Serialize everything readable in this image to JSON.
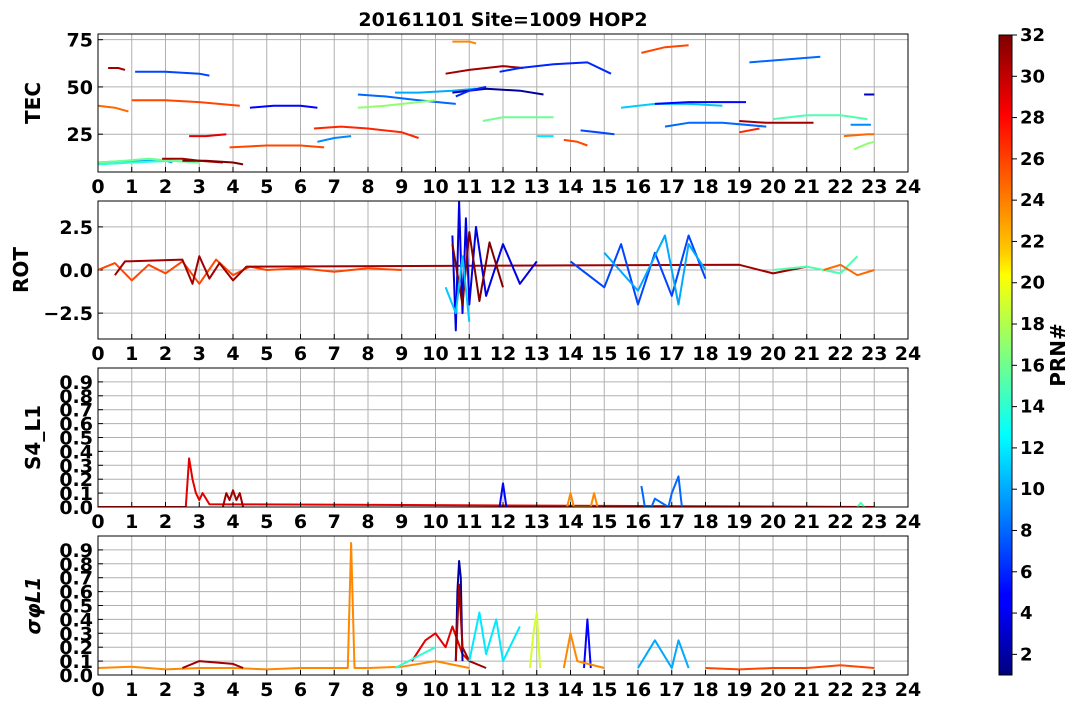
{
  "figure": {
    "title": "20161101 Site=1009 HOP2"
  },
  "x_ticks": [
    "0",
    "1",
    "2",
    "3",
    "4",
    "5",
    "6",
    "7",
    "8",
    "9",
    "10",
    "11",
    "12",
    "13",
    "14",
    "15",
    "16",
    "17",
    "18",
    "19",
    "20",
    "21",
    "22",
    "23",
    "24"
  ],
  "colorbar": {
    "label": "PRN#",
    "ticks": [
      "2",
      "4",
      "6",
      "8",
      "10",
      "12",
      "14",
      "16",
      "18",
      "20",
      "22",
      "24",
      "26",
      "28",
      "30",
      "32"
    ],
    "colormap": "jet",
    "range": [
      1,
      32
    ]
  },
  "chart_data": [
    {
      "type": "line",
      "name": "tec",
      "ylabel": "TEC",
      "xlim": [
        0,
        24
      ],
      "ylim": [
        5,
        78
      ],
      "y_ticks": [
        "25",
        "50",
        "75"
      ],
      "grid": true,
      "series": [
        {
          "prn": 10,
          "x": [
            0.0,
            1.0,
            2.0,
            2.2
          ],
          "y": [
            10,
            11,
            11,
            10
          ]
        },
        {
          "prn": 14,
          "x": [
            0.0,
            1.0,
            2.2,
            3.0
          ],
          "y": [
            9,
            10,
            11,
            10
          ]
        },
        {
          "prn": 16,
          "x": [
            0.0,
            0.8,
            1.5,
            2.2,
            3.0
          ],
          "y": [
            10,
            11,
            12,
            11,
            10
          ]
        },
        {
          "prn": 31,
          "x": [
            1.9,
            2.5,
            3.0,
            3.7
          ],
          "y": [
            12,
            12,
            11,
            10
          ]
        },
        {
          "prn": 32,
          "x": [
            2.5,
            3.2,
            4.0,
            4.3
          ],
          "y": [
            11,
            11,
            10,
            9
          ]
        },
        {
          "prn": 25,
          "x": [
            0.0,
            0.5,
            0.9
          ],
          "y": [
            40,
            39,
            37
          ]
        },
        {
          "prn": 31,
          "x": [
            0.3,
            0.6,
            0.8
          ],
          "y": [
            60,
            60,
            59
          ]
        },
        {
          "prn": 7,
          "x": [
            1.1,
            2.0,
            3.0,
            3.3
          ],
          "y": [
            58,
            58,
            57,
            56
          ]
        },
        {
          "prn": 26,
          "x": [
            1.0,
            2.0,
            3.0,
            4.2
          ],
          "y": [
            43,
            43,
            42,
            40
          ]
        },
        {
          "prn": 29,
          "x": [
            2.7,
            3.2,
            3.8
          ],
          "y": [
            24,
            24,
            25
          ]
        },
        {
          "prn": 26,
          "x": [
            3.9,
            5.0,
            6.0,
            6.7
          ],
          "y": [
            18,
            19,
            19,
            18
          ]
        },
        {
          "prn": 5,
          "x": [
            4.5,
            5.2,
            6.0,
            6.5
          ],
          "y": [
            39,
            40,
            40,
            39
          ]
        },
        {
          "prn": 9,
          "x": [
            6.5,
            7.0,
            7.5
          ],
          "y": [
            21,
            23,
            24
          ]
        },
        {
          "prn": 27,
          "x": [
            6.4,
            7.2,
            8.0,
            9.0,
            9.5
          ],
          "y": [
            28,
            29,
            28,
            26,
            23
          ]
        },
        {
          "prn": 8,
          "x": [
            7.7,
            8.5,
            9.5,
            10.6
          ],
          "y": [
            46,
            45,
            43,
            41
          ]
        },
        {
          "prn": 17,
          "x": [
            7.7,
            8.5,
            9.5,
            10.0
          ],
          "y": [
            39,
            40,
            42,
            43
          ]
        },
        {
          "prn": 10,
          "x": [
            8.8,
            9.5,
            10.5,
            11.2
          ],
          "y": [
            47,
            47,
            48,
            49
          ]
        },
        {
          "prn": 24,
          "x": [
            10.5,
            11.0,
            11.2
          ],
          "y": [
            74,
            74,
            73
          ]
        },
        {
          "prn": 31,
          "x": [
            10.3,
            11.0,
            12.0,
            12.6
          ],
          "y": [
            57,
            59,
            61,
            60
          ]
        },
        {
          "prn": 2,
          "x": [
            10.5,
            11.5,
            12.5,
            13.2
          ],
          "y": [
            47,
            49,
            48,
            46
          ]
        },
        {
          "prn": 6,
          "x": [
            10.6,
            11.0,
            11.5
          ],
          "y": [
            45,
            48,
            50
          ]
        },
        {
          "prn": 6,
          "x": [
            11.9,
            12.5,
            13.5,
            14.5,
            15.2
          ],
          "y": [
            58,
            60,
            62,
            63,
            57
          ]
        },
        {
          "prn": 16,
          "x": [
            11.4,
            12.0,
            13.0,
            13.5
          ],
          "y": [
            32,
            34,
            34,
            34
          ]
        },
        {
          "prn": 12,
          "x": [
            13.0,
            13.5
          ],
          "y": [
            24,
            24
          ]
        },
        {
          "prn": 26,
          "x": [
            13.8,
            14.2,
            14.5
          ],
          "y": [
            22,
            21,
            19
          ]
        },
        {
          "prn": 7,
          "x": [
            14.3,
            14.8,
            15.3
          ],
          "y": [
            27,
            26,
            25
          ]
        },
        {
          "prn": 11,
          "x": [
            15.5,
            16.5,
            17.5,
            18.5
          ],
          "y": [
            39,
            41,
            41,
            40
          ]
        },
        {
          "prn": 5,
          "x": [
            16.5,
            17.5,
            18.5,
            19.2
          ],
          "y": [
            41,
            42,
            42,
            42
          ]
        },
        {
          "prn": 26,
          "x": [
            16.1,
            16.8,
            17.5
          ],
          "y": [
            68,
            71,
            72
          ]
        },
        {
          "prn": 8,
          "x": [
            16.8,
            17.5,
            18.5,
            19.8
          ],
          "y": [
            29,
            31,
            31,
            29
          ]
        },
        {
          "prn": 31,
          "x": [
            19.0,
            19.8,
            20.5,
            21.2
          ],
          "y": [
            32,
            31,
            31,
            31
          ]
        },
        {
          "prn": 27,
          "x": [
            19.0,
            19.6
          ],
          "y": [
            26,
            28
          ]
        },
        {
          "prn": 8,
          "x": [
            19.3,
            20.0,
            21.4
          ],
          "y": [
            63,
            64,
            66
          ]
        },
        {
          "prn": 15,
          "x": [
            20.0,
            21.0,
            22.0,
            22.8
          ],
          "y": [
            33,
            35,
            35,
            33
          ]
        },
        {
          "prn": 9,
          "x": [
            22.3,
            22.9
          ],
          "y": [
            30,
            30
          ]
        },
        {
          "prn": 25,
          "x": [
            22.1,
            22.8,
            23.0
          ],
          "y": [
            24,
            25,
            25
          ]
        },
        {
          "prn": 17,
          "x": [
            22.4,
            22.8,
            23.0
          ],
          "y": [
            17,
            20,
            21
          ]
        },
        {
          "prn": 3,
          "x": [
            22.7,
            23.0
          ],
          "y": [
            46,
            46
          ]
        }
      ]
    },
    {
      "type": "line",
      "name": "rot",
      "ylabel": "ROT",
      "xlim": [
        0,
        24
      ],
      "ylim": [
        -4,
        4
      ],
      "y_ticks": [
        "2.5",
        "0.0",
        "−2.5"
      ],
      "grid": true,
      "series": [
        {
          "prn": 26,
          "x": [
            0.0,
            0.5,
            1.0,
            1.5,
            2.0,
            2.5,
            3.0,
            3.5,
            4.0,
            4.5,
            5.0,
            6.0,
            7.0,
            8.0,
            9.0
          ],
          "y": [
            0.0,
            0.4,
            -0.6,
            0.3,
            -0.2,
            0.5,
            -0.8,
            0.6,
            -0.3,
            0.2,
            0.0,
            0.1,
            -0.1,
            0.1,
            0.0
          ]
        },
        {
          "prn": 31,
          "x": [
            0.5,
            0.8,
            2.5,
            2.8,
            3.0,
            3.3,
            3.6,
            4.0,
            4.4,
            19.0,
            20.0,
            21.0
          ],
          "y": [
            -0.3,
            0.5,
            0.6,
            -0.8,
            0.8,
            -0.5,
            0.4,
            -0.6,
            0.2,
            0.3,
            -0.2,
            0.2
          ]
        },
        {
          "prn": 4,
          "x": [
            10.5,
            10.6,
            10.7,
            10.8,
            10.9,
            11.0,
            11.2,
            11.5,
            12.0,
            12.5,
            13.0
          ],
          "y": [
            2.0,
            -3.5,
            4.0,
            -2.5,
            3.0,
            -2.0,
            2.5,
            -1.5,
            1.5,
            -0.8,
            0.5
          ]
        },
        {
          "prn": 32,
          "x": [
            10.5,
            10.8,
            11.0,
            11.3,
            11.6,
            12.0
          ],
          "y": [
            1.5,
            -2.0,
            2.2,
            -1.8,
            1.6,
            -1.0
          ]
        },
        {
          "prn": 11,
          "x": [
            10.3,
            10.6,
            10.8,
            11.0
          ],
          "y": [
            -1.0,
            -2.5,
            0.8,
            -3.0
          ]
        },
        {
          "prn": 7,
          "x": [
            14.0,
            15.0,
            15.5,
            16.0,
            16.5,
            17.0,
            17.5,
            18.0
          ],
          "y": [
            0.5,
            -1.0,
            1.5,
            -2.0,
            1.0,
            -1.5,
            2.0,
            -0.5
          ]
        },
        {
          "prn": 10,
          "x": [
            15.0,
            16.0,
            16.8,
            17.2,
            17.5,
            18.0
          ],
          "y": [
            1.0,
            -1.2,
            2.0,
            -2.0,
            1.5,
            0.0
          ]
        },
        {
          "prn": 15,
          "x": [
            20.0,
            21.0,
            22.0,
            22.5
          ],
          "y": [
            0.0,
            0.2,
            -0.2,
            0.8
          ]
        },
        {
          "prn": 25,
          "x": [
            21.5,
            22.0,
            22.5,
            23.0
          ],
          "y": [
            0.0,
            0.3,
            -0.3,
            0.0
          ]
        }
      ]
    },
    {
      "type": "line",
      "name": "s4",
      "ylabel": "S4_L1",
      "xlim": [
        0,
        24
      ],
      "ylim": [
        0,
        1.0
      ],
      "y_ticks": [
        "0.9",
        "0.8",
        "0.7",
        "0.6",
        "0.5",
        "0.4",
        "0.3",
        "0.2",
        "0.1",
        "0.0"
      ],
      "grid": true,
      "series": [
        {
          "prn": 29,
          "x": [
            0.0,
            2.6,
            2.7,
            2.8,
            2.9,
            3.0,
            3.1,
            3.3,
            23.0
          ],
          "y": [
            0.0,
            0.0,
            0.35,
            0.2,
            0.1,
            0.05,
            0.1,
            0.02,
            0.0
          ]
        },
        {
          "prn": 31,
          "x": [
            3.7,
            3.8,
            3.9,
            4.0,
            4.1,
            4.2,
            4.3
          ],
          "y": [
            0.0,
            0.1,
            0.05,
            0.12,
            0.05,
            0.1,
            0.0
          ]
        },
        {
          "prn": 5,
          "x": [
            11.9,
            12.0,
            12.1
          ],
          "y": [
            0.0,
            0.17,
            0.0
          ]
        },
        {
          "prn": 24,
          "x": [
            13.9,
            14.0,
            14.1,
            14.6,
            14.7,
            14.8
          ],
          "y": [
            0.0,
            0.1,
            0.0,
            0.0,
            0.1,
            0.0
          ]
        },
        {
          "prn": 8,
          "x": [
            16.1,
            16.15,
            16.2,
            16.4,
            16.5,
            16.9,
            17.0,
            17.2,
            17.3
          ],
          "y": [
            0.15,
            0.08,
            0.0,
            0.0,
            0.06,
            0.0,
            0.1,
            0.22,
            0.0
          ]
        },
        {
          "prn": 15,
          "x": [
            22.5,
            22.6,
            22.7
          ],
          "y": [
            0.0,
            0.03,
            0.0
          ]
        }
      ]
    },
    {
      "type": "line",
      "name": "sigphi",
      "ylabel": "σφL1",
      "xlim": [
        0,
        24
      ],
      "ylim": [
        0,
        1.0
      ],
      "y_ticks": [
        "0.9",
        "0.8",
        "0.7",
        "0.6",
        "0.5",
        "0.4",
        "0.3",
        "0.2",
        "0.1",
        "0.0"
      ],
      "grid": true,
      "series": [
        {
          "prn": 24,
          "x": [
            0.0,
            1.0,
            2.0,
            3.0,
            4.0,
            5.0,
            6.0,
            7.0,
            7.4,
            7.5,
            7.6,
            8.0,
            9.0,
            10.0,
            11.0
          ],
          "y": [
            0.05,
            0.06,
            0.04,
            0.05,
            0.05,
            0.04,
            0.05,
            0.05,
            0.05,
            0.95,
            0.05,
            0.05,
            0.06,
            0.1,
            0.05
          ]
        },
        {
          "prn": 31,
          "x": [
            2.5,
            3.0,
            4.0,
            4.3
          ],
          "y": [
            0.05,
            0.1,
            0.08,
            0.05
          ]
        },
        {
          "prn": 29,
          "x": [
            9.3,
            9.7,
            10.0,
            10.3,
            10.5,
            10.8,
            11.0
          ],
          "y": [
            0.1,
            0.25,
            0.3,
            0.2,
            0.35,
            0.15,
            0.1
          ]
        },
        {
          "prn": 14,
          "x": [
            8.8,
            9.2,
            9.6,
            10.0
          ],
          "y": [
            0.05,
            0.1,
            0.15,
            0.2
          ]
        },
        {
          "prn": 2,
          "x": [
            10.6,
            10.65,
            10.7,
            10.75,
            10.8
          ],
          "y": [
            0.1,
            0.6,
            0.82,
            0.7,
            0.1
          ]
        },
        {
          "prn": 31,
          "x": [
            10.6,
            10.7,
            10.8,
            11.0,
            11.5
          ],
          "y": [
            0.1,
            0.65,
            0.2,
            0.1,
            0.05
          ]
        },
        {
          "prn": 12,
          "x": [
            11.0,
            11.3,
            11.5,
            11.8,
            12.0,
            12.5
          ],
          "y": [
            0.1,
            0.45,
            0.15,
            0.4,
            0.1,
            0.35
          ]
        },
        {
          "prn": 19,
          "x": [
            12.8,
            12.9,
            13.0,
            13.1
          ],
          "y": [
            0.05,
            0.3,
            0.45,
            0.05
          ]
        },
        {
          "prn": 5,
          "x": [
            14.4,
            14.5,
            14.6
          ],
          "y": [
            0.05,
            0.4,
            0.05
          ]
        },
        {
          "prn": 24,
          "x": [
            13.8,
            14.0,
            14.2,
            15.0
          ],
          "y": [
            0.05,
            0.3,
            0.1,
            0.05
          ]
        },
        {
          "prn": 10,
          "x": [
            16.0,
            16.5,
            17.0,
            17.2,
            17.5
          ],
          "y": [
            0.05,
            0.25,
            0.05,
            0.25,
            0.05
          ]
        },
        {
          "prn": 26,
          "x": [
            18.0,
            19.0,
            20.0,
            21.0,
            22.0,
            23.0
          ],
          "y": [
            0.05,
            0.04,
            0.05,
            0.05,
            0.07,
            0.05
          ]
        }
      ]
    }
  ]
}
